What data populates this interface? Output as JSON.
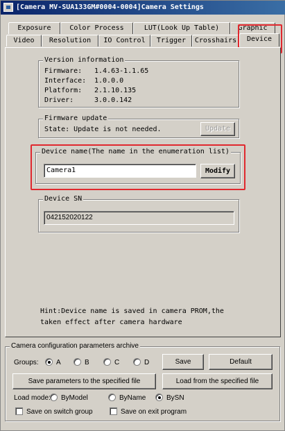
{
  "window": {
    "title": "[Camera MV-SUA133GM#0004-0004]Camera Settings"
  },
  "tabs_row1": [
    {
      "label": "Exposure"
    },
    {
      "label": "Color Process"
    },
    {
      "label": "LUT(Look Up Table)"
    },
    {
      "label": "Graphic"
    }
  ],
  "tabs_row2": [
    {
      "label": "Video"
    },
    {
      "label": "Resolution"
    },
    {
      "label": "IO Control"
    },
    {
      "label": "Trigger"
    },
    {
      "label": "Crosshairs"
    },
    {
      "label": "Device",
      "active": true
    }
  ],
  "version": {
    "title": "Version information",
    "rows": [
      {
        "label": "Firmware:",
        "value": "1.4.63-1.1.65"
      },
      {
        "label": "Interface:",
        "value": "1.0.0.0"
      },
      {
        "label": "Platform:",
        "value": "2.1.10.135"
      },
      {
        "label": "Driver:",
        "value": "3.0.0.142"
      }
    ]
  },
  "firmware_update": {
    "title": "Firmware update",
    "state": "State: Update is not needed.",
    "button": "Update"
  },
  "device_name": {
    "title": "Device name(The name in the enumeration list)",
    "value": "Camera1",
    "button": "Modify"
  },
  "device_sn": {
    "title": "Device SN",
    "value": "042152020122"
  },
  "hint": {
    "line1": "Hint:Device name is saved in camera PROM,the",
    "line2": "taken effect after camera hardware"
  },
  "archive": {
    "title": "Camera configuration parameters archive",
    "groups_label": "Groups:",
    "groups": [
      {
        "label": "A",
        "checked": true
      },
      {
        "label": "B",
        "checked": false
      },
      {
        "label": "C",
        "checked": false
      },
      {
        "label": "D",
        "checked": false
      }
    ],
    "save": "Save",
    "default": "Default",
    "save_file": "Save parameters to the specified file",
    "load_file": "Load from the specified file",
    "load_mode_label": "Load mode:",
    "load_modes": [
      {
        "label": "ByModel",
        "checked": false
      },
      {
        "label": "ByName",
        "checked": false
      },
      {
        "label": "BySN",
        "checked": true
      }
    ],
    "save_on_switch": "Save on switch group",
    "save_on_exit": "Save on exit program"
  },
  "colors": {
    "highlight": "#e0282e",
    "titlebar": "#0a246a",
    "face": "#d4d0c8"
  }
}
